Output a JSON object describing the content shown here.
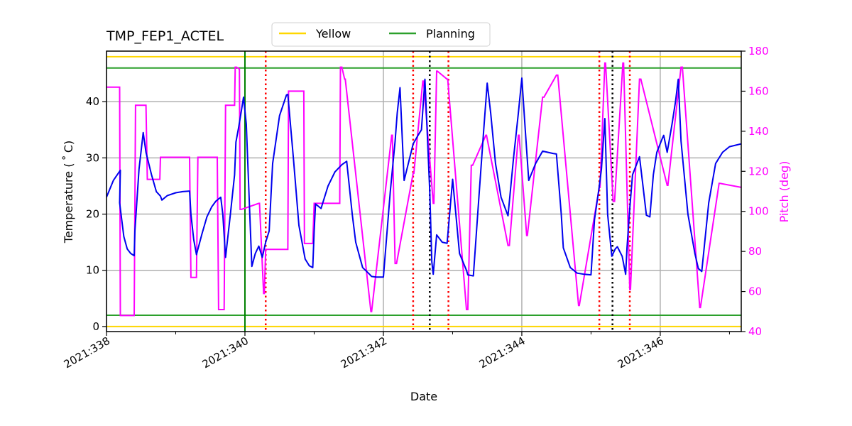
{
  "chart_data": {
    "type": "line",
    "title": "TMP_FEP1_ACTEL",
    "xlabel": "Date",
    "ylabel": "Temperature ($^\\circ$C)",
    "ylabel_display": "Temperature ( ˚ C)",
    "y2label": "Pitch (deg)",
    "xlim": [
      338.0,
      347.17
    ],
    "ylim": [
      -0.9,
      49.0
    ],
    "y2lim": [
      40,
      180
    ],
    "grid": true,
    "legend_position": "top-center-outside",
    "x_ticks": [
      338,
      340,
      342,
      344,
      346
    ],
    "x_tick_labels": [
      "2021:338",
      "2021:340",
      "2021:342",
      "2021:344",
      "2021:346"
    ],
    "x_minor_ticks": [
      339,
      341,
      343,
      345,
      347
    ],
    "y_ticks": [
      0,
      10,
      20,
      30,
      40
    ],
    "y2_ticks": [
      40,
      60,
      80,
      100,
      120,
      140,
      160,
      180
    ],
    "colors": {
      "temperature": "#0000ee",
      "pitch": "#ff00ff",
      "yellow_limit": "#ffd700",
      "planning_limit": "#2ca02c",
      "now_line": "#008000",
      "red_markers": "#ff0000",
      "black_markers": "#000000",
      "grid": "#b0b0b0"
    },
    "legend": [
      {
        "label": "Yellow",
        "color": "#ffd700"
      },
      {
        "label": "Planning",
        "color": "#2ca02c"
      }
    ],
    "limits": {
      "yellow_high": 48.0,
      "yellow_low": 0.0,
      "planning_high": 46.0,
      "planning_low": 2.0
    },
    "now_line_x": 340.0,
    "red_dotted_x": [
      340.3,
      342.43,
      342.94,
      345.12,
      345.56
    ],
    "black_dotted_x": [
      342.67,
      345.31
    ],
    "series": [
      {
        "name": "Temperature",
        "axis": "left",
        "x": [
          338.0,
          338.1,
          338.2,
          338.19,
          338.25,
          338.3,
          338.35,
          338.4,
          338.41,
          338.47,
          338.53,
          338.57,
          338.65,
          338.72,
          338.78,
          338.8,
          338.88,
          339.0,
          339.1,
          339.2,
          339.22,
          339.26,
          339.3,
          339.38,
          339.45,
          339.52,
          339.58,
          339.65,
          339.68,
          339.72,
          339.79,
          339.85,
          339.87,
          339.91,
          339.95,
          339.98,
          340.02,
          340.07,
          340.1,
          340.15,
          340.2,
          340.25,
          340.3,
          340.35,
          340.4,
          340.5,
          340.6,
          340.62,
          340.7,
          340.78,
          340.87,
          340.93,
          340.98,
          341.0,
          341.02,
          341.1,
          341.2,
          341.3,
          341.4,
          341.47,
          341.55,
          341.6,
          341.7,
          341.8,
          341.83,
          341.9,
          342.0,
          342.1,
          342.17,
          342.2,
          342.24,
          342.3,
          342.4,
          342.43,
          342.5,
          342.55,
          342.6,
          342.67,
          342.7,
          342.72,
          342.77,
          342.85,
          342.92,
          343.0,
          343.1,
          343.2,
          343.22,
          343.3,
          343.38,
          343.45,
          343.5,
          343.55,
          343.62,
          343.7,
          343.8,
          343.88,
          343.95,
          344.0,
          344.05,
          344.1,
          344.2,
          344.3,
          344.45,
          344.5,
          344.57,
          344.6,
          344.7,
          344.8,
          344.9,
          345.0,
          345.05,
          345.12,
          345.15,
          345.2,
          345.24,
          345.3,
          345.35,
          345.38,
          345.45,
          345.5,
          345.52,
          345.56,
          345.6,
          345.7,
          345.75,
          345.8,
          345.85,
          345.9,
          345.95,
          346.03,
          346.05,
          346.1,
          346.17,
          346.22,
          346.26,
          346.3,
          346.4,
          346.5,
          346.55,
          346.6,
          346.7,
          346.8,
          346.9,
          347.0,
          347.17
        ],
        "y": [
          23.0,
          26.0,
          27.8,
          22.0,
          16.0,
          13.8,
          13.0,
          12.6,
          17.0,
          28.0,
          34.5,
          31.0,
          27.0,
          24.0,
          23.2,
          22.5,
          23.3,
          23.8,
          24.0,
          24.1,
          20.0,
          15.5,
          12.8,
          16.5,
          19.5,
          21.3,
          22.3,
          23.0,
          20.0,
          12.3,
          20.0,
          27.0,
          32.8,
          35.5,
          38.5,
          40.8,
          36.0,
          20.0,
          10.7,
          13.0,
          14.3,
          12.3,
          15.0,
          17.0,
          29.0,
          37.5,
          41.2,
          41.3,
          30.0,
          18.0,
          12.0,
          10.8,
          10.5,
          17.0,
          21.8,
          21.0,
          25.0,
          27.5,
          28.8,
          29.4,
          20.0,
          15.0,
          10.5,
          9.3,
          8.9,
          8.8,
          8.8,
          24.0,
          33.0,
          38.0,
          42.5,
          26.0,
          31.0,
          32.5,
          34.0,
          35.0,
          44.0,
          24.0,
          11.5,
          9.3,
          16.3,
          15.0,
          14.8,
          26.2,
          13.0,
          10.0,
          9.2,
          9.0,
          23.0,
          35.0,
          43.3,
          38.0,
          29.0,
          23.0,
          19.7,
          30.0,
          38.0,
          44.2,
          35.0,
          26.0,
          29.0,
          31.2,
          30.8,
          30.7,
          20.0,
          14.0,
          10.5,
          9.5,
          9.3,
          9.2,
          19.0,
          25.0,
          28.0,
          37.0,
          20.0,
          12.5,
          13.8,
          14.2,
          12.5,
          9.3,
          14.0,
          21.0,
          27.0,
          30.2,
          25.0,
          19.8,
          19.5,
          27.0,
          31.0,
          33.5,
          34.0,
          31.0,
          36.0,
          40.0,
          44.0,
          33.0,
          20.0,
          13.0,
          10.3,
          9.8,
          22.0,
          29.0,
          31.0,
          32.0,
          32.5,
          32.8
        ]
      },
      {
        "name": "Pitch",
        "axis": "right",
        "x": [
          338.0,
          338.19,
          338.2,
          338.4,
          338.42,
          338.57,
          338.59,
          338.77,
          338.78,
          339.2,
          339.22,
          339.3,
          339.32,
          339.6,
          339.62,
          339.7,
          339.72,
          339.85,
          339.86,
          339.88,
          339.92,
          339.93,
          339.95,
          340.2,
          340.21,
          340.27,
          340.28,
          340.3,
          340.62,
          340.63,
          340.85,
          340.86,
          340.98,
          341.0,
          341.37,
          341.38,
          341.4,
          341.44,
          341.45,
          341.82,
          341.83,
          342.12,
          342.13,
          342.17,
          342.19,
          342.43,
          342.44,
          342.57,
          342.58,
          342.72,
          342.73,
          342.77,
          342.78,
          342.92,
          342.93,
          343.2,
          343.22,
          343.27,
          343.29,
          343.48,
          343.49,
          343.8,
          343.82,
          343.95,
          343.96,
          344.07,
          344.08,
          344.3,
          344.32,
          344.5,
          344.52,
          344.82,
          344.83,
          345.12,
          345.13,
          345.2,
          345.21,
          345.32,
          345.34,
          345.46,
          345.47,
          345.56,
          345.57,
          345.7,
          345.72,
          346.1,
          346.11,
          346.3,
          346.32,
          346.57,
          346.58,
          346.85,
          346.86,
          347.17
        ],
        "y": [
          162,
          162,
          48,
          48,
          153,
          153,
          116,
          116,
          127,
          127,
          67,
          67,
          127,
          127,
          51,
          51,
          153,
          153,
          172,
          172,
          171,
          101,
          101,
          104,
          104,
          59,
          59,
          81,
          81,
          160,
          160,
          84,
          84,
          104,
          104,
          172,
          172,
          166,
          166,
          50,
          50,
          138,
          138,
          74,
          74,
          119,
          119,
          165,
          165,
          104,
          104,
          170,
          170,
          166,
          166,
          51,
          51,
          123,
          123,
          138,
          138,
          83,
          83,
          138,
          138,
          88,
          88,
          157,
          157,
          168,
          168,
          53,
          53,
          112,
          112,
          174,
          174,
          105,
          105,
          174,
          174,
          61,
          61,
          166,
          166,
          113,
          113,
          172,
          172,
          52,
          52,
          114,
          114,
          112
        ]
      }
    ]
  }
}
